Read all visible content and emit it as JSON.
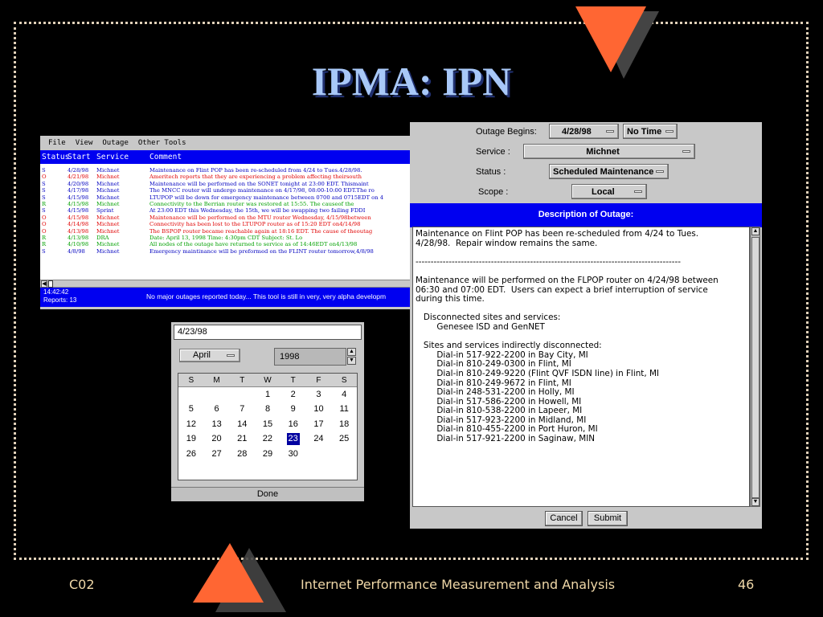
{
  "slide": {
    "title": "IPMA: IPN",
    "footer_left": "C02",
    "footer_center": "Internet Performance Measurement and Analysis",
    "footer_right": "46",
    "colors": {
      "accent_triangle": "#ff6633",
      "title": "#a8c8f8",
      "frame_dots": "#e0d0b8"
    }
  },
  "outage_list": {
    "menu": [
      "File",
      "View",
      "Outage",
      "Other Tools"
    ],
    "columns": [
      "Status",
      "Start",
      "Service",
      "Comment"
    ],
    "rows": [
      {
        "status": "S",
        "start": "4/28/98",
        "service": "Michnet",
        "comment": "Maintenance on Flint POP has been re-scheduled from 4/24 to Tues.4/28/98.",
        "color": "#0000c0"
      },
      {
        "status": "O",
        "start": "4/21/98",
        "service": "Michnet",
        "comment": "Ameritech reports that they are experiencing a problem affecting theirsouth",
        "color": "#e00000"
      },
      {
        "status": "S",
        "start": "4/20/98",
        "service": "Michnet",
        "comment": "Maintenance will be performed on the SONET tonight at 23:00 EDT.  Thismaint",
        "color": "#0000c0"
      },
      {
        "status": "S",
        "start": "4/17/98",
        "service": "Michnet",
        "comment": "The MNCC router will undergo maintenance on 4/17/98, 08:00-10:00 EDT.The ro",
        "color": "#0000c0"
      },
      {
        "status": "S",
        "start": "4/15/98",
        "service": "Michnet",
        "comment": "LTUPOP will be down for emergency maintenance between 0700 and 0715EDT on 4",
        "color": "#0000c0"
      },
      {
        "status": "R",
        "start": "4/15/98",
        "service": "Michnet",
        "comment": "Connectivity to the Berrian router was restored at 15:55.  The causeof the",
        "color": "#00a000"
      },
      {
        "status": "S",
        "start": "4/15/98",
        "service": "Sprint",
        "comment": "At 23:00 EDT this Wednesday, the 15th, we will be swapping two failing FDDI",
        "color": "#0000c0"
      },
      {
        "status": "O",
        "start": "4/15/98",
        "service": "Michnet",
        "comment": " Maintenance will be performed on the MTU router Wednesday, 4/15/98between",
        "color": "#e00000"
      },
      {
        "status": "O",
        "start": "4/14/98",
        "service": "Michnet",
        "comment": "Connectivity has been lost to the LTUPOP router as of 15:20 EDT on4/14/98",
        "color": "#e00000"
      },
      {
        "status": "O",
        "start": "4/13/98",
        "service": "Michnet",
        "comment": "The BSPOP router became reachable again at 18:16 EDT.  The cause of theoutag",
        "color": "#e00000"
      },
      {
        "status": "R",
        "start": "4/13/98",
        "service": "DRA",
        "comment": "        Date: April 13, 1998        Time: 4:30pm CDT        Subject: St. Lo",
        "color": "#00a000"
      },
      {
        "status": "R",
        "start": "4/10/98",
        "service": "Michnet",
        "comment": "All nodes of the outage have returned to service as of 14:46EDT on4/13/98",
        "color": "#00a000"
      },
      {
        "status": "S",
        "start": "4/8/98",
        "service": "Michnet",
        "comment": "Emergency maintinance will be preformed on the FLINT router tomorrow,4/8/98",
        "color": "#0000c0"
      }
    ],
    "status_time": "14:42:42",
    "status_reports": "Reports: 13",
    "status_message": "No major outages reported today...   This tool is still in very, very alpha developm"
  },
  "date_picker": {
    "date_value": "4/23/98",
    "month": "April",
    "year": "1998",
    "weekdays": [
      "S",
      "M",
      "T",
      "W",
      "T",
      "F",
      "S"
    ],
    "weeks": [
      [
        "",
        "",
        "",
        "1",
        "2",
        "3",
        "4"
      ],
      [
        "5",
        "6",
        "7",
        "8",
        "9",
        "10",
        "11"
      ],
      [
        "12",
        "13",
        "14",
        "15",
        "16",
        "17",
        "18"
      ],
      [
        "19",
        "20",
        "21",
        "22",
        "23",
        "24",
        "25"
      ],
      [
        "26",
        "27",
        "28",
        "29",
        "30",
        "",
        ""
      ]
    ],
    "selected_day": "23",
    "done_label": "Done"
  },
  "outage_form": {
    "begins_label": "Outage Begins:",
    "begins_date": "4/28/98",
    "begins_time": "No Time",
    "service_label": "Service :",
    "service_value": "Michnet",
    "status_label": "Status :",
    "status_value": "Scheduled Maintenance",
    "scope_label": "Scope :",
    "scope_value": "Local",
    "description_header": "Description of Outage:",
    "description": "Maintenance on Flint POP has been re-scheduled from 4/24 to Tues.\n4/28/98.  Repair window remains the same.\n\n----------------------------------------------------------------------------------------\n\nMaintenance will be performed on the FLPOP router on 4/24/98 between\n06:30 and 07:00 EDT.  Users can expect a brief interruption of service\nduring this time.\n\n   Disconnected sites and services:\n        Genesee ISD and GenNET\n\n   Sites and services indirectly disconnected:\n        Dial-in 517-922-2200 in Bay City, MI\n        Dial-in 810-249-0300 in Flint, MI\n        Dial-in 810-249-9220 (Flint QVF ISDN line) in Flint, MI\n        Dial-in 810-249-9672 in Flint, MI\n        Dial-in 248-531-2200 in Holly, MI\n        Dial-in 517-586-2200 in Howell, MI\n        Dial-in 810-538-2200 in Lapeer, MI\n        Dial-in 517-923-2200 in Midland, MI\n        Dial-in 810-455-2200 in Port Huron, MI\n        Dial-in 517-921-2200 in Saginaw, MIN",
    "cancel_label": "Cancel",
    "submit_label": "Submit"
  }
}
